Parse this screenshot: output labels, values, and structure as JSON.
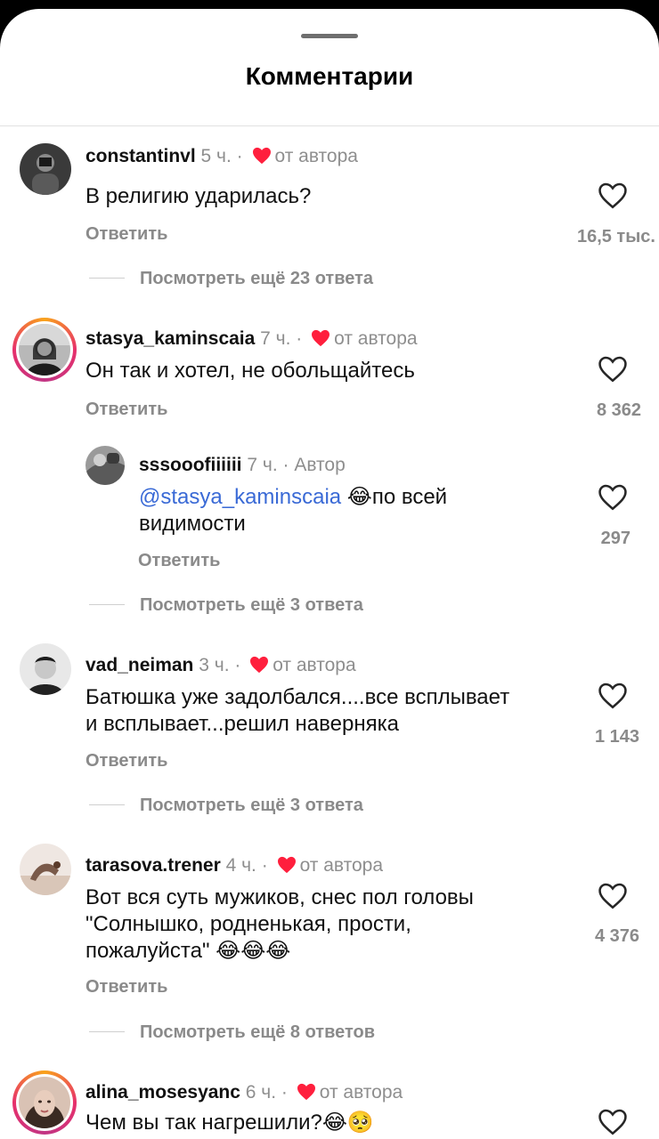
{
  "header": {
    "title": "Комментарии"
  },
  "comments": [
    {
      "username": "constantinvl",
      "time": "5 ч.",
      "liked_by": "от автора",
      "text": "В религию ударилась?",
      "reply_label": "Ответить",
      "likes": "16,5 тыс.",
      "more_replies": "Посмотреть ещё 23 ответа"
    },
    {
      "username": "stasya_kaminscaia",
      "time": "7 ч.",
      "liked_by": "от автора",
      "text": "Он так и хотел, не обольщайтесь",
      "reply_label": "Ответить",
      "likes": "8 362"
    },
    {
      "username": "sssooofiiiiii",
      "time": "7 ч.",
      "author_tag": "Автор",
      "mention": "@stasya_kaminscaia",
      "emoji": "😂",
      "text_after": "по всей",
      "text_line2": "видимости",
      "reply_label": "Ответить",
      "likes": "297",
      "more_replies": "Посмотреть ещё 3 ответа"
    },
    {
      "username": "vad_neiman",
      "time": "3 ч.",
      "liked_by": "от автора",
      "text_line1": "Батюшка уже задолбался....все всплывает",
      "text_line2": "и всплывает...решил наверняка",
      "reply_label": "Ответить",
      "likes": "1 143",
      "more_replies": "Посмотреть ещё 3 ответа"
    },
    {
      "username": "tarasova.trener",
      "time": "4 ч.",
      "liked_by": "от автора",
      "text_line1": "Вот вся суть мужиков, снес пол головы",
      "text_line2": "\"Солнышко, родненькая, прости,",
      "text_line3": "пожалуйста\"",
      "emojis": "😂😂😂",
      "reply_label": "Ответить",
      "likes": "4 376",
      "more_replies": "Посмотреть ещё 8 ответов"
    },
    {
      "username": "alina_mosesyanc",
      "time": "6 ч.",
      "liked_by": "от автора",
      "text": "Чем вы так нагрешили?",
      "emojis": "😂🥺"
    }
  ],
  "icons": {
    "like": "heart-outline-icon",
    "creator_like": "red-heart-icon"
  },
  "colors": {
    "creator_heart": "#ff1f3d",
    "mention": "#3a6ad6",
    "muted": "#8a8a8a"
  }
}
